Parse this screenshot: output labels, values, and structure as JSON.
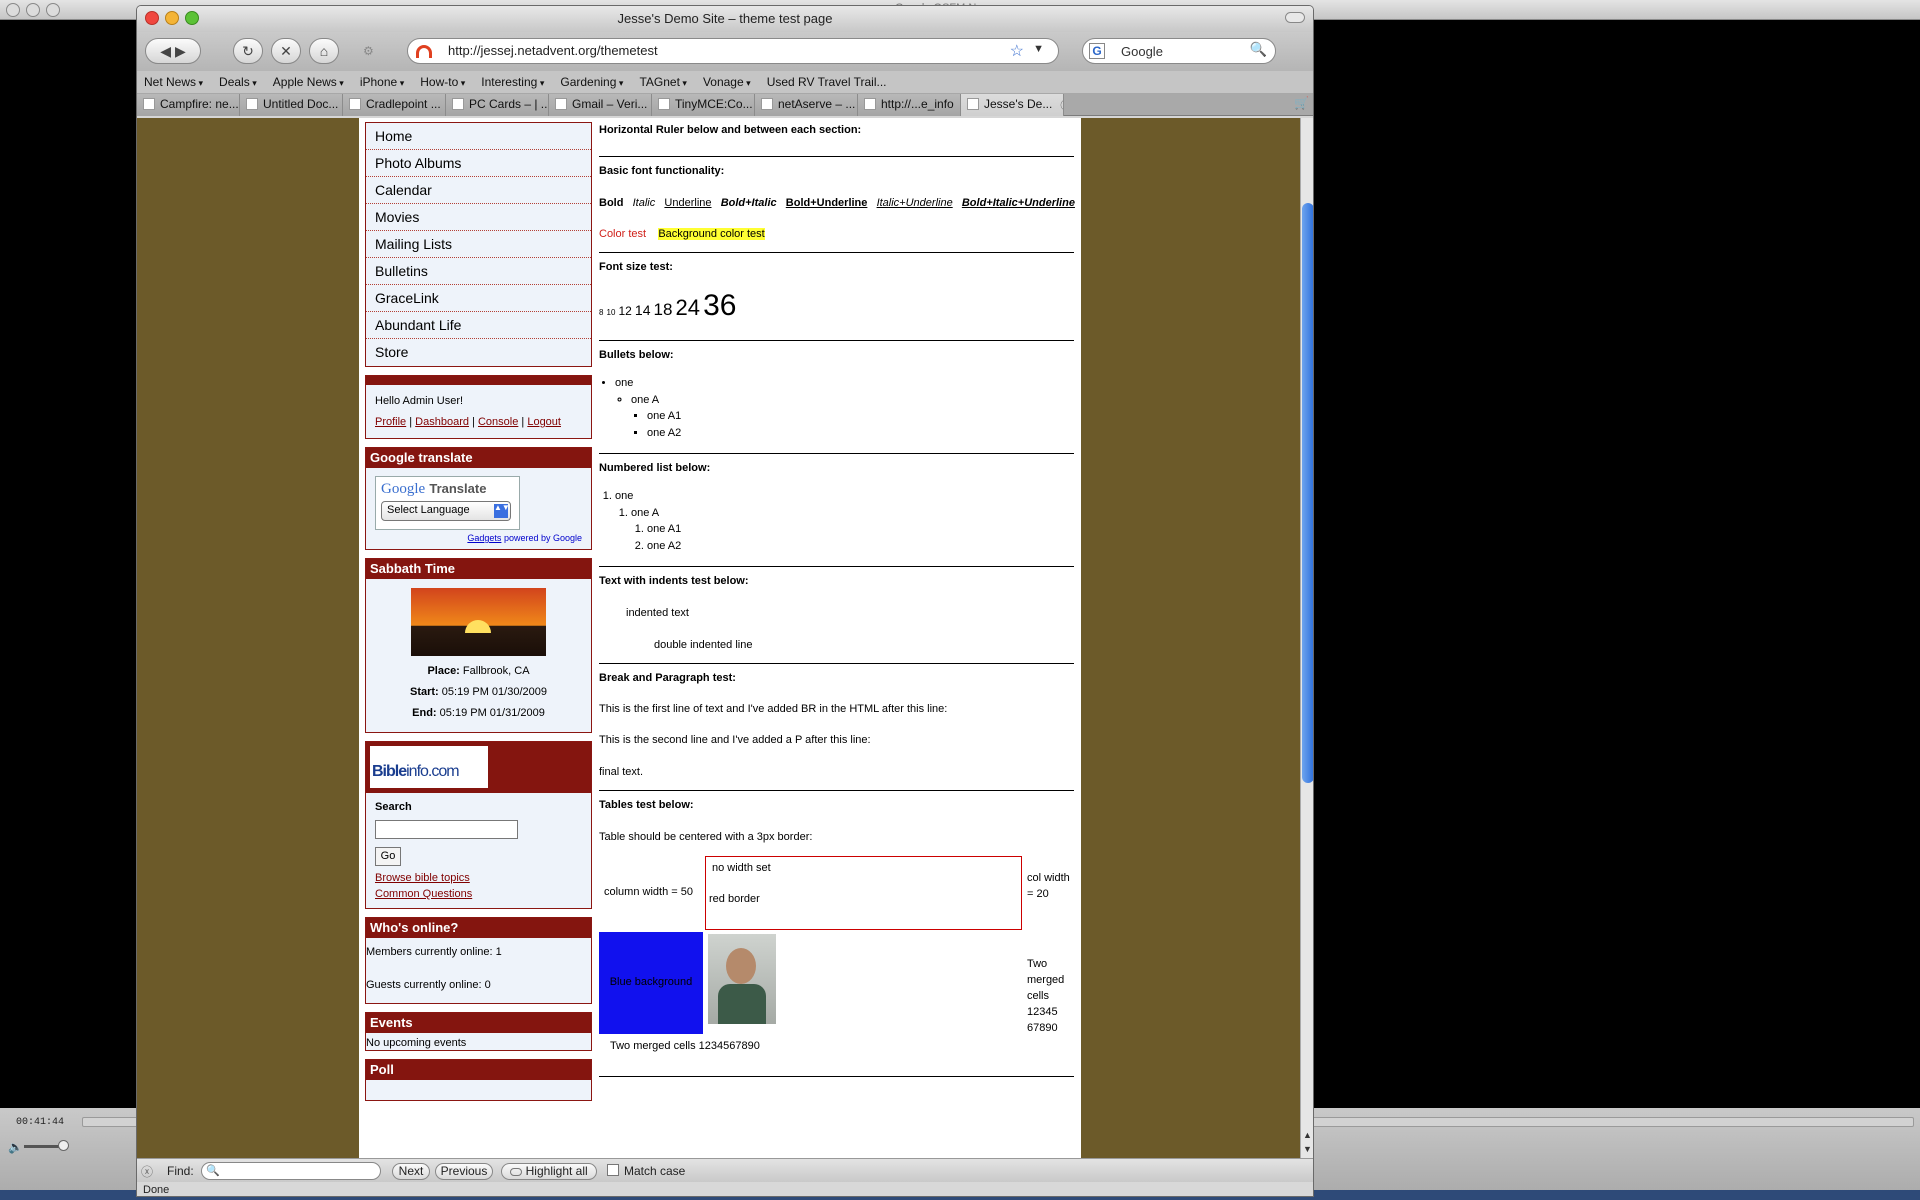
{
  "background": {
    "app_title": "Google OSFM Nano...",
    "time": "00:41:44"
  },
  "window": {
    "title": "Jesse's Demo Site – theme test page"
  },
  "nav": {
    "url": "http://jessej.netadvent.org/themetest",
    "search_value": "Google"
  },
  "bookmarks": [
    {
      "label": "Net News",
      "menu": true
    },
    {
      "label": "Deals",
      "menu": true
    },
    {
      "label": "Apple News",
      "menu": true
    },
    {
      "label": "iPhone",
      "menu": true
    },
    {
      "label": "How-to",
      "menu": true
    },
    {
      "label": "Interesting",
      "menu": true
    },
    {
      "label": "Gardening",
      "menu": true
    },
    {
      "label": "TAGnet",
      "menu": true
    },
    {
      "label": "Vonage",
      "menu": true
    },
    {
      "label": "Used RV Travel Trail...",
      "menu": false
    }
  ],
  "tabs": [
    "Campfire: ne...",
    "Untitled Doc...",
    "Cradlepoint ...",
    "PC Cards – | ...",
    "Gmail – Veri...",
    "TinyMCE:Co...",
    "netAserve – ...",
    "http://...e_info",
    "Jesse's De..."
  ],
  "sidebar": {
    "menu": [
      "Home",
      "Photo Albums",
      "Calendar",
      "Movies",
      "Mailing Lists",
      "Bulletins",
      "GraceLink",
      "Abundant Life",
      "Store"
    ],
    "user": {
      "greeting": "Hello Admin User!",
      "links": [
        "Profile",
        "Dashboard",
        "Console",
        "Logout"
      ]
    },
    "translate": {
      "title": "Google translate",
      "logo_google": "Google",
      "logo_translate": "Translate",
      "select": "Select Language",
      "gadgets": "Gadgets",
      "powered": "powered by Google"
    },
    "sabbath": {
      "title": "Sabbath Time",
      "place_label": "Place:",
      "place": "Fallbrook, CA",
      "start_label": "Start:",
      "start": "05:19 PM 01/30/2009",
      "end_label": "End:",
      "end": "05:19 PM 01/31/2009"
    },
    "bibleinfo": {
      "logo_bible": "Bible",
      "logo_info": "info.com",
      "search_label": "Search",
      "go": "Go",
      "link1": "Browse bible topics",
      "link2": "Common Questions"
    },
    "online": {
      "title": "Who's online?",
      "members": "Members currently online: 1",
      "guests": "Guests currently online: 0"
    },
    "events": {
      "title": "Events",
      "text": "No upcoming events"
    },
    "poll": {
      "title": "Poll"
    }
  },
  "content": {
    "ruler_title": "Horizontal Ruler below and between each section:",
    "font_title": "Basic font functionality:",
    "font_samples": [
      "Bold",
      "Italic",
      "Underline",
      "Bold+Italic",
      "Bold+Underline",
      "Italic+Underline",
      "Bold+Italic+Underline"
    ],
    "color_test": "Color test",
    "bg_color_test": "Background color test",
    "size_title": "Font size test:",
    "sizes": [
      "8",
      "10",
      "12",
      "14",
      "18",
      "24",
      "36"
    ],
    "bullets_title": "Bullets below:",
    "list_one": "one",
    "list_oneA": "one A",
    "list_oneA1": "one A1",
    "list_oneA2": "one A2",
    "numbered_title": "Numbered list below:",
    "indent_title": "Text with indents test below:",
    "indent1": "indented text",
    "indent2": "double indented line",
    "break_title": "Break and Paragraph test:",
    "break1": "This is the first line of text and I've added BR in the HTML after this line:",
    "break2": "This is the second line and I've added a P after this line:",
    "break3": "final text.",
    "tables_title": "Tables test below:",
    "table_note": "Table should be centered with a 3px border:",
    "table": {
      "c1": "column width = 50",
      "c2a": "no width set",
      "c2b": "red border",
      "c3": "col width = 20",
      "blue": "Blue background",
      "merged_right": "Two merged cells 12345 67890",
      "merged_bottom": "Two merged cells 1234567890"
    }
  },
  "findbar": {
    "label": "Find:",
    "next": "Next",
    "previous": "Previous",
    "highlight": "Highlight all",
    "match_case": "Match case"
  },
  "status": "Done",
  "colors": {
    "sidebar_header": "#84150f",
    "page_bg": "#6c5a29",
    "table_blue": "#1111ee",
    "highlight": "#ffff33"
  }
}
